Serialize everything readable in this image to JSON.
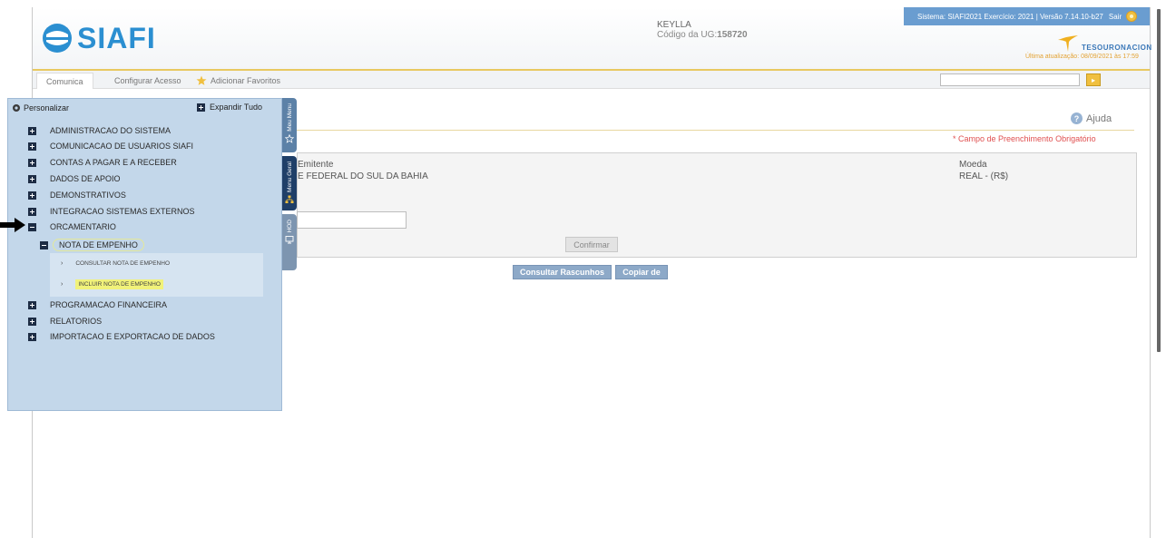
{
  "app": {
    "logo_text": "SIAFI",
    "user_name": "KEYLLA",
    "ug_label": "Código da UG:",
    "ug_value": "158720",
    "system_info": "Sistema: SIAFI2021 Exercício: 2021 | Versão 7.14.10-b27",
    "sair_label": "Sair",
    "tesouro_text": "TESOURONACIONAL",
    "last_update": "Última atualização: 08/09/2021 às 17:59"
  },
  "toolbar": {
    "tab_comunica": "Comunica",
    "tab_config": "Configurar Acesso",
    "tab_favoritos": "Adicionar Favoritos",
    "search_value": "",
    "go_symbol": "▸"
  },
  "menu": {
    "personalizar": "Personalizar",
    "expandir": "Expandir Tudo",
    "items": [
      {
        "label": "ADMINISTRACAO DO SISTEMA"
      },
      {
        "label": "COMUNICACAO DE USUARIOS SIAFI"
      },
      {
        "label": "CONTAS A PAGAR E A RECEBER"
      },
      {
        "label": "DADOS DE APOIO"
      },
      {
        "label": "DEMONSTRATIVOS"
      },
      {
        "label": "INTEGRACAO SISTEMAS EXTERNOS"
      },
      {
        "label": "ORCAMENTARIO"
      },
      {
        "label": "PROGRAMACAO FINANCEIRA"
      },
      {
        "label": "RELATORIOS"
      },
      {
        "label": "IMPORTACAO E EXPORTACAO DE DADOS"
      }
    ],
    "submenu_label": "NOTA DE EMPENHO",
    "sub_items": [
      {
        "label": "CONSULTAR NOTA DE EMPENHO"
      },
      {
        "label": "INCLUIR NOTA DE EMPENHO"
      }
    ],
    "side_tabs": {
      "meu_menu": "Meu Menu",
      "menu_geral": "Menu Geral",
      "hod": "HOD"
    }
  },
  "content": {
    "ajuda": "Ajuda",
    "required_note": "* Campo de Preenchimento Obrigatório",
    "emitente_label": "Emitente",
    "emitente_value": "E FEDERAL DO SUL DA BAHIA",
    "moeda_label": "Moeda",
    "moeda_value": "REAL - (R$)",
    "field_value": "",
    "confirmar": "Confirmar",
    "consultar_rascunhos": "Consultar Rascunhos",
    "copiar_de": "Copiar de"
  },
  "colors": {
    "logo_blue": "#2b8fd1",
    "menu_bg": "#c3d7ea",
    "highlight_yellow": "#f1f27a",
    "required_red": "#e05050",
    "sysbar_blue": "#6a9dd0"
  }
}
